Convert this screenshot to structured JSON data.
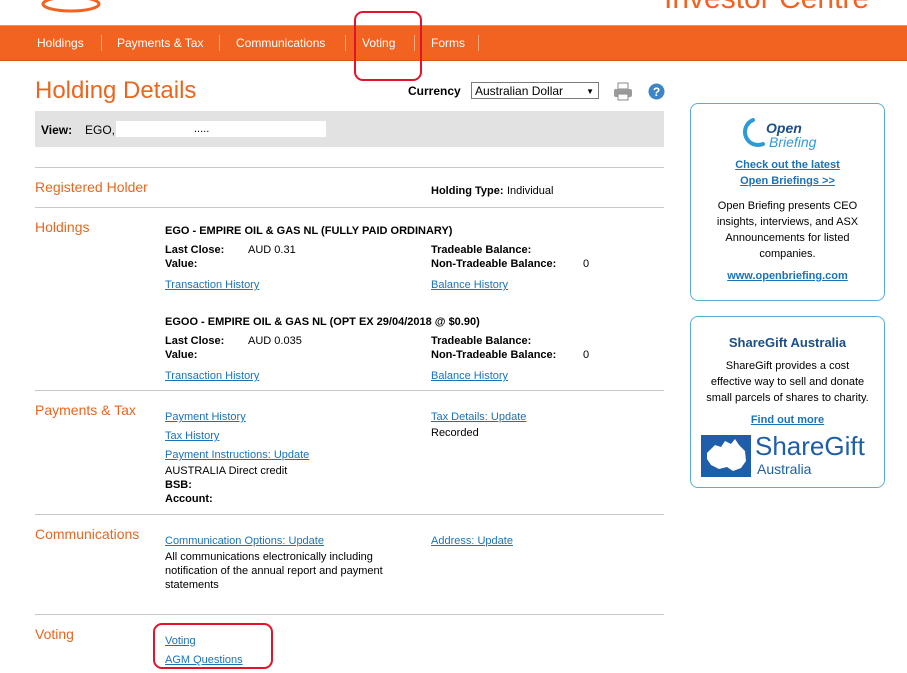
{
  "header": {
    "brand": "Investor Centre"
  },
  "nav": {
    "items": [
      {
        "label": "Holdings"
      },
      {
        "label": "Payments & Tax"
      },
      {
        "label": "Communications"
      },
      {
        "label": "Voting"
      },
      {
        "label": "Forms"
      }
    ]
  },
  "page": {
    "title": "Holding Details",
    "currency_label": "Currency",
    "currency_value": "Australian Dollar",
    "view_label": "View:",
    "view_value": "EGO, ,",
    "view_dots": "....."
  },
  "registered_holder": {
    "title": "Registered Holder",
    "type_label": "Holding Type:",
    "type_value": "Individual"
  },
  "holdings": {
    "title": "Holdings",
    "items": [
      {
        "name": "EGO - EMPIRE OIL & GAS NL (FULLY PAID ORDINARY)",
        "last_close_label": "Last Close:",
        "last_close_value": "AUD 0.31",
        "value_label": "Value:",
        "tradeable_label": "Tradeable Balance:",
        "non_tradeable_label": "Non-Tradeable Balance:",
        "non_tradeable_value": "0",
        "transaction_link": "Transaction History",
        "balance_link": "Balance History"
      },
      {
        "name": "EGOO - EMPIRE OIL & GAS NL (OPT EX 29/04/2018 @ $0.90)",
        "last_close_label": "Last Close:",
        "last_close_value": "AUD 0.035",
        "value_label": "Value:",
        "tradeable_label": "Tradeable Balance:",
        "non_tradeable_label": "Non-Tradeable Balance:",
        "non_tradeable_value": "0",
        "transaction_link": "Transaction History",
        "balance_link": "Balance History"
      }
    ]
  },
  "payments": {
    "title": "Payments & Tax",
    "payment_history": "Payment History",
    "tax_history": "Tax History",
    "payment_instructions": "Payment Instructions: Update",
    "method": "AUSTRALIA Direct credit",
    "bsb_label": "BSB:",
    "account_label": "Account:",
    "tax_details": "Tax Details: Update",
    "tax_status": "Recorded"
  },
  "communications": {
    "title": "Communications",
    "options_link": "Communication Options: Update",
    "desc_line1": "All communications electronically including",
    "desc_line2": "notification of the annual report and payment",
    "desc_line3": "statements",
    "address_link": "Address: Update"
  },
  "voting": {
    "title": "Voting",
    "voting_link": "Voting",
    "agm_link": "AGM Questions"
  },
  "sidebar": {
    "open_briefing": {
      "logo_top": "Open",
      "logo_bottom": "Briefing",
      "link_line1": "Check out the latest",
      "link_line2": "Open Briefings >>",
      "desc_lines": [
        "Open Briefing presents CEO",
        "insights, interviews, and ASX",
        "Announcements for listed",
        "companies."
      ],
      "url": "www.openbriefing.com"
    },
    "sharegift": {
      "title": "ShareGift Australia",
      "desc_lines": [
        "ShareGift provides a cost",
        "effective way to sell and donate",
        "small parcels of shares to charity."
      ],
      "link": "Find out more",
      "logo_name": "ShareGift",
      "logo_sub": "Australia"
    }
  },
  "colors": {
    "brand_orange": "#f26322",
    "heading_orange": "#e8661f",
    "link_blue": "#1a73b8",
    "annotation_red": "#e0142a"
  }
}
